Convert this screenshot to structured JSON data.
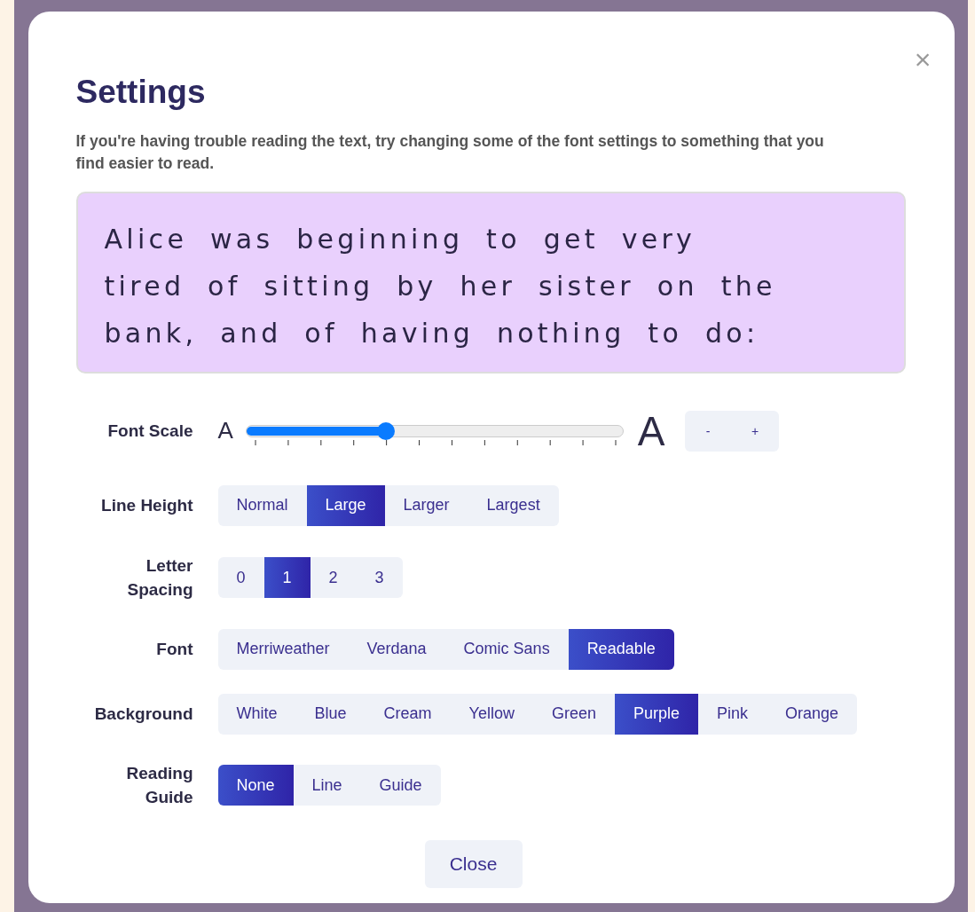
{
  "dialog": {
    "title": "Settings",
    "close_icon": "×",
    "description": "If you're having trouble reading the text, try changing some of the font settings to something that you find easier to read.",
    "preview": {
      "lines": [
        "Alice was beginning to get very",
        "tired of sitting by her sister on the",
        "bank, and of having nothing to do:"
      ]
    },
    "font_scale": {
      "label": "Font Scale",
      "small_glyph": "A",
      "large_glyph": "A",
      "level": 0.37,
      "decrease": "-",
      "increase": "+"
    },
    "options": [
      {
        "label": "Line Height",
        "choices": [
          {
            "label": "Normal",
            "selected": false
          },
          {
            "label": "Large",
            "selected": true
          },
          {
            "label": "Larger",
            "selected": false
          },
          {
            "label": "Largest",
            "selected": false
          }
        ]
      },
      {
        "label": "Letter Spacing",
        "choices": [
          {
            "label": "0",
            "selected": false
          },
          {
            "label": "1",
            "selected": true
          },
          {
            "label": "2",
            "selected": false
          },
          {
            "label": "3",
            "selected": false
          }
        ]
      },
      {
        "label": "Font",
        "choices": [
          {
            "label": "Merriweather",
            "selected": false
          },
          {
            "label": "Verdana",
            "selected": false
          },
          {
            "label": "Comic Sans",
            "selected": false
          },
          {
            "label": "Readable",
            "selected": true
          }
        ]
      },
      {
        "label": "Background",
        "choices": [
          {
            "label": "White",
            "selected": false
          },
          {
            "label": "Blue",
            "selected": false
          },
          {
            "label": "Cream",
            "selected": false
          },
          {
            "label": "Yellow",
            "selected": false
          },
          {
            "label": "Green",
            "selected": false
          },
          {
            "label": "Purple",
            "selected": true
          },
          {
            "label": "Pink",
            "selected": false
          },
          {
            "label": "Orange",
            "selected": false
          }
        ]
      },
      {
        "label": "Reading Guide",
        "choices": [
          {
            "label": "None",
            "selected": true
          },
          {
            "label": "Line",
            "selected": false
          },
          {
            "label": "Guide",
            "selected": false
          }
        ]
      }
    ],
    "close_button": "Close"
  }
}
